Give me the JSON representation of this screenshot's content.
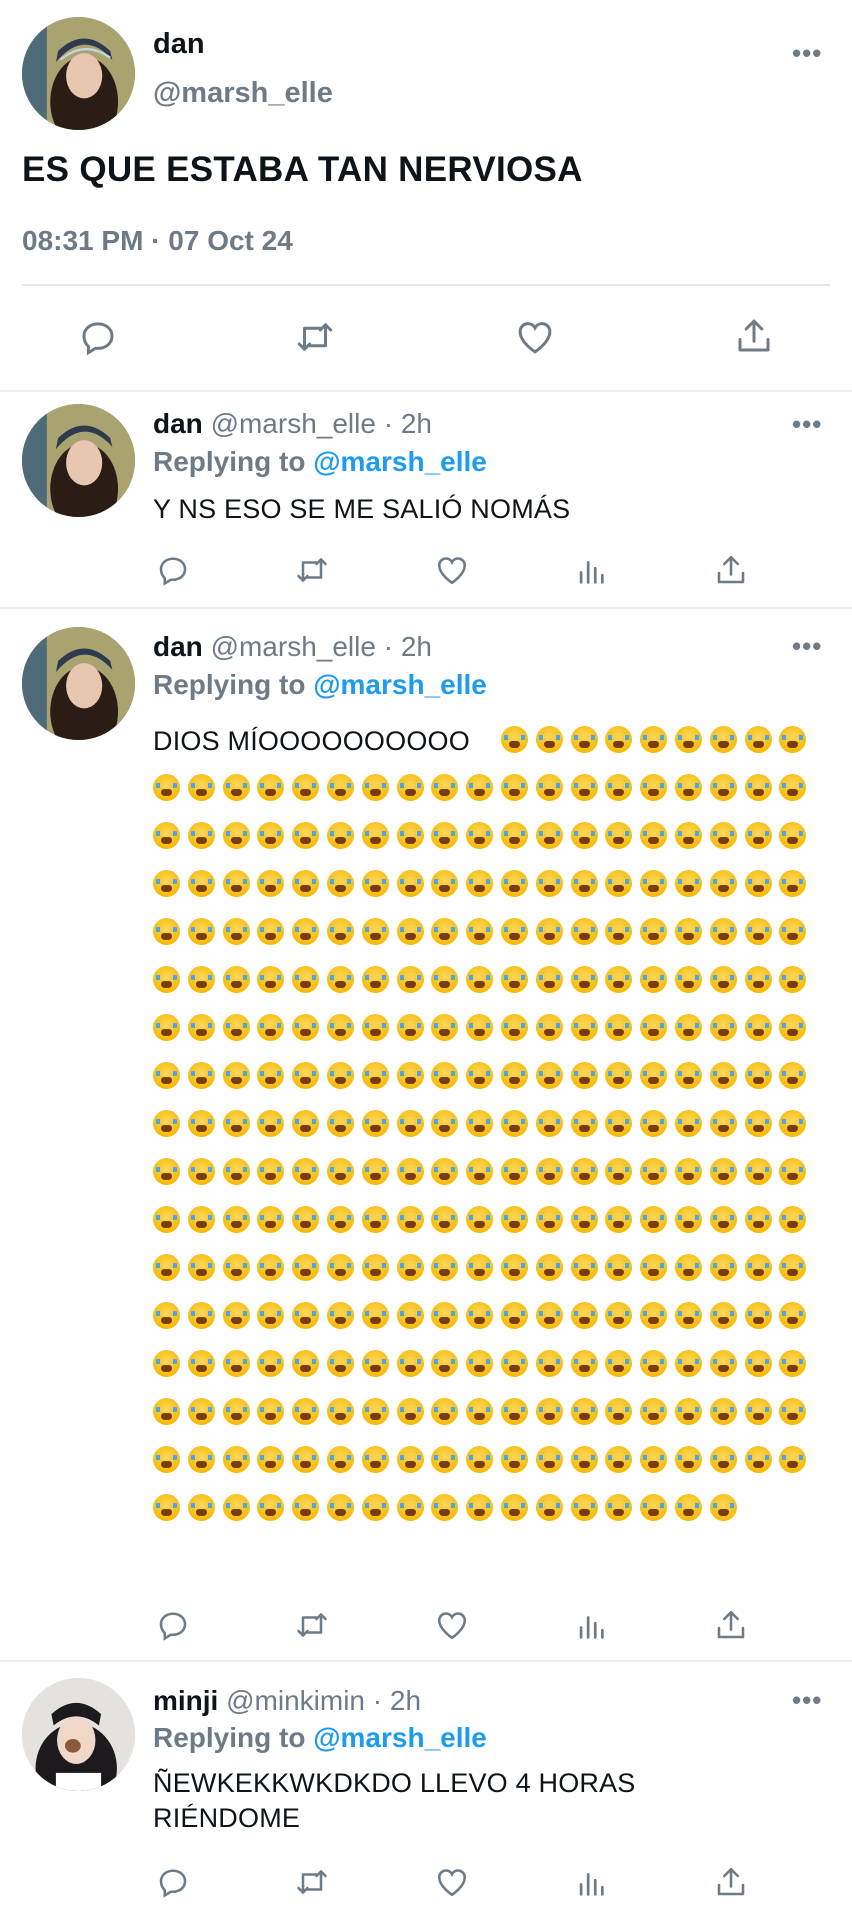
{
  "main_tweet": {
    "name": "dan",
    "handle": "@marsh_elle",
    "text": "ES QUE ESTABA TAN NERVIOSA",
    "timestamp": "08:31 PM · 07 Oct 24",
    "more_label": "•••"
  },
  "replies": [
    {
      "name": "dan",
      "meta": "@marsh_elle · 2h",
      "replying_prefix": "Replying to",
      "replying_handle": "@marsh_elle",
      "text": "Y NS ESO SE ME SALIÓ NOMÁS",
      "more_label": "•••"
    },
    {
      "name": "dan",
      "meta": "@marsh_elle · 2h",
      "replying_prefix": "Replying to",
      "replying_handle": "@marsh_elle",
      "text": "DIOS MÍOOOOOOOOOO",
      "emoji_name": "loudly-crying-face",
      "emoji_count": 311,
      "more_label": "•••"
    },
    {
      "name": "minji",
      "meta": "@minkimin · 2h",
      "replying_prefix": "Replying to",
      "replying_handle": "@marsh_elle",
      "text_line1": "ÑEWKEKKWKDKDO LLEVO 4 HORAS",
      "text_line2": "RIÉNDOME",
      "more_label": "•••"
    }
  ],
  "colors": {
    "secondary_text": "#6e7b87",
    "link": "#1d9bf0",
    "divider": "#eceef0"
  }
}
